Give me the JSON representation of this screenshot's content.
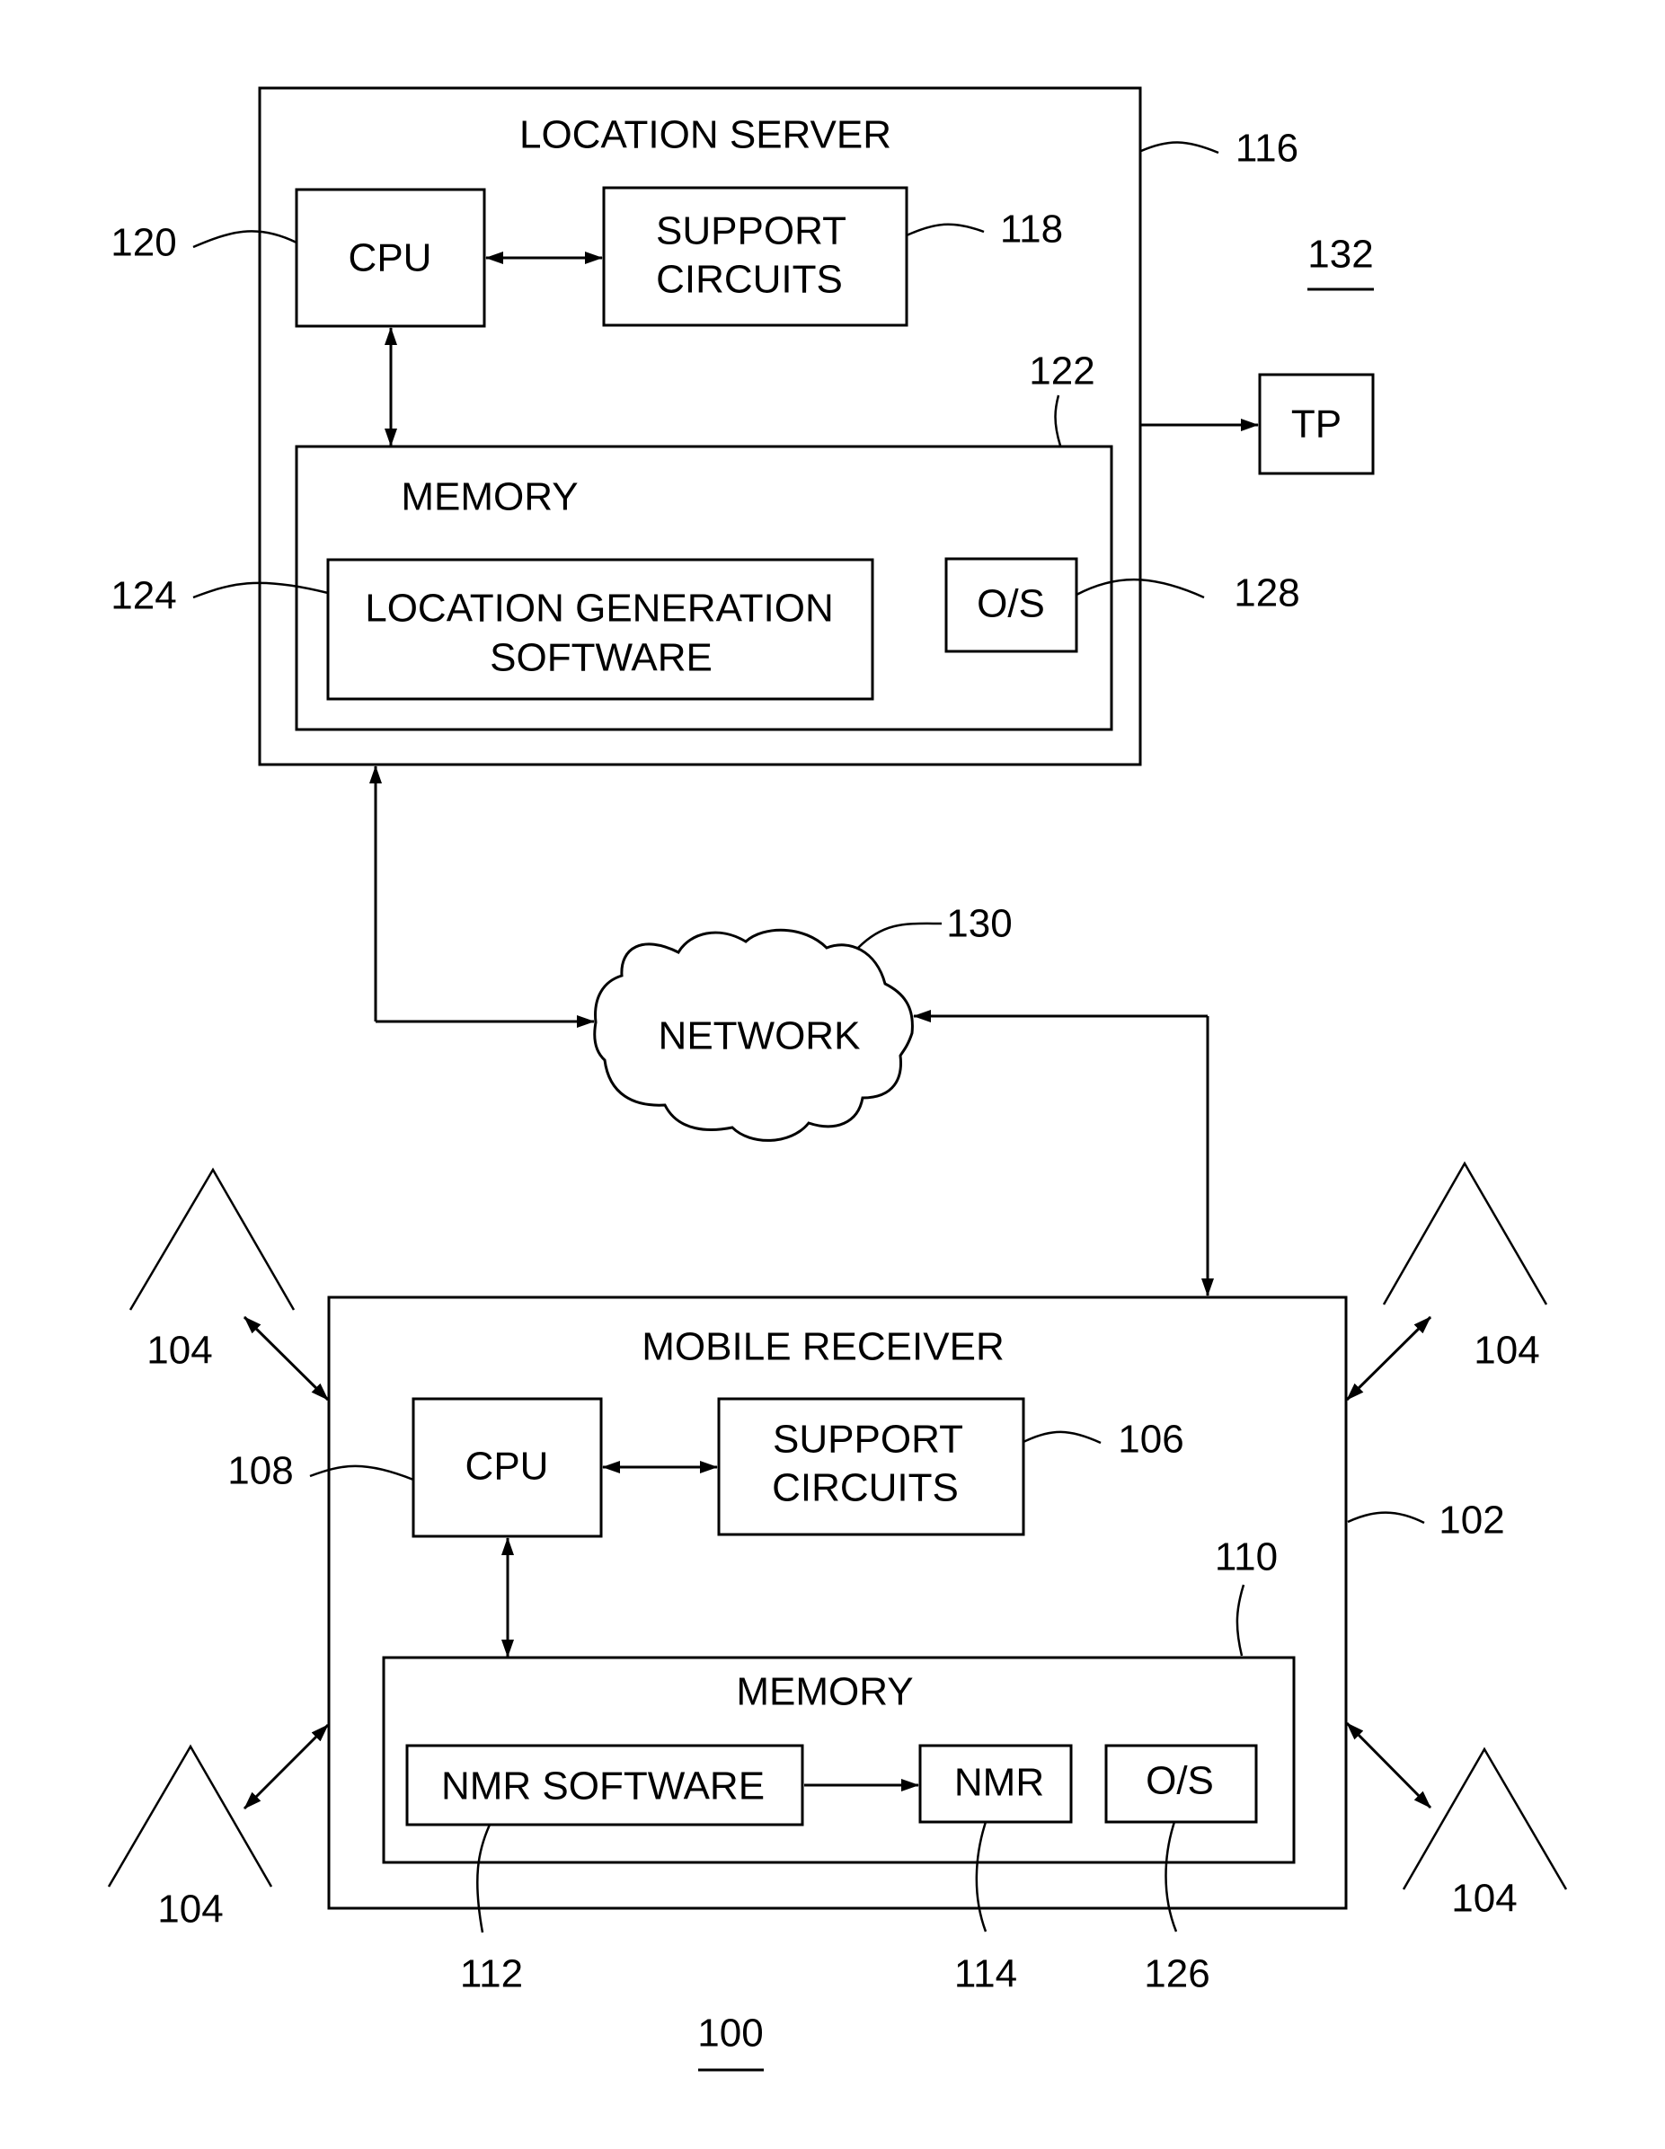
{
  "figure": {
    "figure_ref": "100",
    "system_ref": "132"
  },
  "location_server": {
    "title": "LOCATION SERVER",
    "ref": "116",
    "cpu": {
      "label": "CPU",
      "ref": "120"
    },
    "support_circuits": {
      "label_line1": "SUPPORT",
      "label_line2": "CIRCUITS",
      "ref": "118"
    },
    "memory": {
      "label": "MEMORY",
      "ref": "122",
      "location_generation_software": {
        "label_line1": "LOCATION GENERATION",
        "label_line2": "SOFTWARE",
        "ref": "124"
      },
      "os": {
        "label": "O/S",
        "ref": "128"
      }
    }
  },
  "tp": {
    "label": "TP"
  },
  "network": {
    "label": "NETWORK",
    "ref": "130"
  },
  "mobile_receiver": {
    "title": "MOBILE RECEIVER",
    "ref": "102",
    "cpu": {
      "label": "CPU",
      "ref": "108"
    },
    "support_circuits": {
      "label_line1": "SUPPORT",
      "label_line2": "CIRCUITS",
      "ref": "106"
    },
    "memory": {
      "label": "MEMORY",
      "ref": "110",
      "nmr_software": {
        "label": "NMR SOFTWARE",
        "ref": "112"
      },
      "nmr": {
        "label": "NMR",
        "ref": "114"
      },
      "os": {
        "label": "O/S",
        "ref": "126"
      }
    }
  },
  "antennas": [
    {
      "ref": "104",
      "position": "top-left"
    },
    {
      "ref": "104",
      "position": "top-right"
    },
    {
      "ref": "104",
      "position": "bottom-left"
    },
    {
      "ref": "104",
      "position": "bottom-right"
    }
  ]
}
